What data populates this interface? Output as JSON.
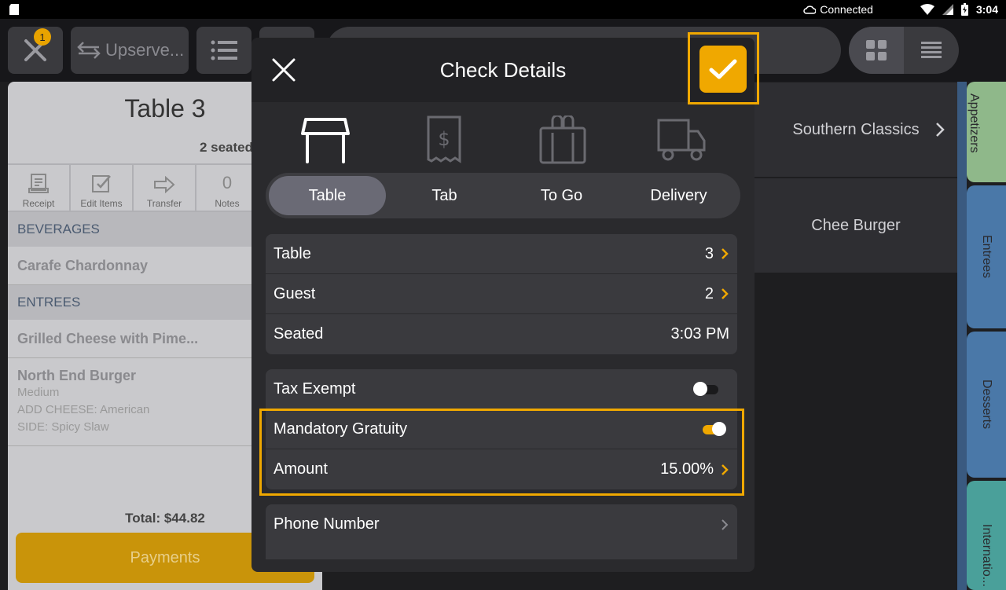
{
  "status_bar": {
    "connection": "Connected",
    "time": "3:04"
  },
  "topbar": {
    "badge_count": "1",
    "upserve_label": "Upserve..."
  },
  "check": {
    "title": "Table 3",
    "seated": "2 seated",
    "actions": [
      {
        "label": "Receipt"
      },
      {
        "label": "Edit Items"
      },
      {
        "label": "Transfer"
      },
      {
        "label": "Notes",
        "count": "0"
      }
    ],
    "sections": [
      {
        "name": "BEVERAGES",
        "items": [
          {
            "name": "Carafe Chardonnay"
          }
        ]
      },
      {
        "name": "ENTREES",
        "items": [
          {
            "name": "Grilled Cheese with Pime..."
          },
          {
            "name": "North End Burger",
            "modifiers": [
              "Medium",
              "ADD CHEESE: American",
              "SIDE: Spicy Slaw"
            ]
          }
        ]
      }
    ],
    "total": "Total: $44.82",
    "payments_label": "Payments"
  },
  "menu": {
    "tiles": [
      "Southern Classics",
      "Chee Burger"
    ],
    "side_tabs": [
      {
        "label": "Appetizers",
        "color": "#8fb88a"
      },
      {
        "label": "Entrees",
        "color": "#4a78a8"
      },
      {
        "label": "Desserts",
        "color": "#4a78a8"
      },
      {
        "label": "Internatio...",
        "color": "#4aa09a"
      }
    ]
  },
  "modal": {
    "title": "Check Details",
    "order_types": [
      "Table",
      "Tab",
      "To Go",
      "Delivery"
    ],
    "selected_type": "Table",
    "details": [
      {
        "label": "Table",
        "value": "3"
      },
      {
        "label": "Guest",
        "value": "2"
      },
      {
        "label": "Seated",
        "value": "3:03 PM"
      }
    ],
    "tax_exempt": {
      "label": "Tax Exempt",
      "on": false
    },
    "gratuity": {
      "label": "Mandatory Gratuity",
      "on": true
    },
    "amount": {
      "label": "Amount",
      "value": "15.00%"
    },
    "phone": {
      "label": "Phone Number"
    }
  },
  "colors": {
    "accent": "#f0a800",
    "modal_bg": "#2a2a2d",
    "row_bg": "#3a3a3e"
  }
}
